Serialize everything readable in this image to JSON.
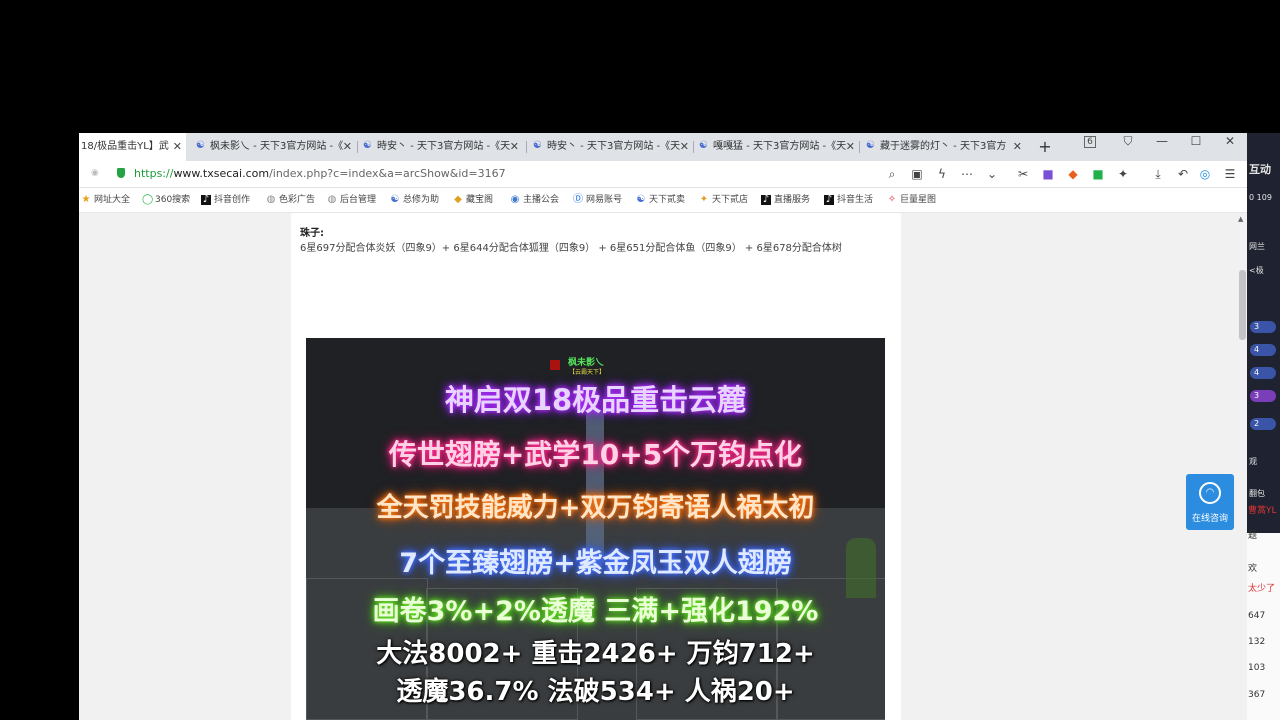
{
  "tabs": [
    {
      "label": "18/极品重击YL】武",
      "active": true
    },
    {
      "label": "枫未影乀 - 天下3官方网站 -《",
      "active": false
    },
    {
      "label": "時安丶 - 天下3官方网站 -《天",
      "active": false
    },
    {
      "label": "時安丶 - 天下3官方网站 -《天",
      "active": false
    },
    {
      "label": "嘎嘎猛 - 天下3官方网站 -《天",
      "active": false
    },
    {
      "label": "藏于迷雾的灯丶 - 天下3官方",
      "active": false
    }
  ],
  "window_controls": {
    "tab_count": "6",
    "shirt": "⛉",
    "minimize": "—",
    "maximize": "☐",
    "close": "✕"
  },
  "address": {
    "scheme": "https://",
    "host": "www.txsecai.com",
    "path": "/index.php?c=index&a=arcShow&id=3167"
  },
  "bookmarks": [
    "网址大全",
    "360搜索",
    "抖音创作",
    "色彩广告",
    "后台管理",
    "总修为助",
    "藏宝阁",
    "主播公会",
    "网易账号",
    "天下贰卖",
    "天下贰店",
    "直播服务",
    "抖音生活",
    "巨量星图"
  ],
  "article": {
    "pearl_title": "珠子:",
    "pearl_text": "6星697分配合体炎妖（四象9）+ 6星644分配合体狐狸（四象9） +  6星651分配合体鱼（四象9） + 6星678分配合体树"
  },
  "game_image": {
    "player_name": "枫未影乀",
    "guild": "【云霸天下】",
    "lines": [
      "神启双18极品重击云麓",
      "传世翅膀+武学10+5个万钧点化",
      "全天罚技能威力+双万钧寄语人祸太初",
      "7个至臻翅膀+紫金凤玉双人翅膀",
      "画卷3%+2%透魔 三满+强化192%",
      "大法8002+ 重击2426+ 万钧712+",
      "透魔36.7% 法破534+ 人祸20+"
    ]
  },
  "consult": {
    "label": "在线咨询"
  },
  "side_panel": {
    "title": "互动",
    "items": [
      "0 109",
      "网兰",
      "<极",
      "3",
      "4",
      "4",
      "3",
      "2",
      "观",
      "翻包",
      "曹蒿YL",
      "题",
      "欢",
      "太少了",
      "647",
      "132",
      "103",
      "367"
    ]
  }
}
